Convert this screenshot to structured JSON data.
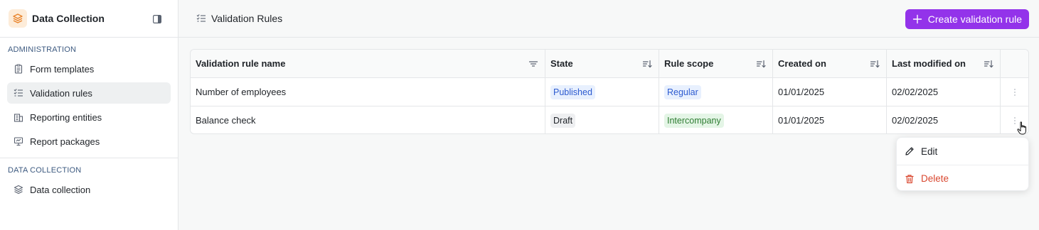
{
  "sidebar": {
    "app_title": "Data Collection",
    "sections": [
      {
        "title": "ADMINISTRATION",
        "items": [
          {
            "label": "Form templates",
            "icon": "clipboard-icon"
          },
          {
            "label": "Validation rules",
            "icon": "checklist-icon",
            "active": true
          },
          {
            "label": "Reporting entities",
            "icon": "building-icon"
          },
          {
            "label": "Report packages",
            "icon": "presentation-icon"
          }
        ]
      },
      {
        "title": "DATA COLLECTION",
        "items": [
          {
            "label": "Data collection",
            "icon": "layers-icon"
          }
        ]
      }
    ]
  },
  "header": {
    "title": "Validation Rules",
    "create_button": "Create validation rule",
    "accent_color": "#9333ea"
  },
  "table": {
    "columns": [
      "Validation rule name",
      "State",
      "Rule scope",
      "Created on",
      "Last modified on"
    ],
    "rows": [
      {
        "name": "Number of employees",
        "state": "Published",
        "scope": "Regular",
        "created": "01/01/2025",
        "modified": "02/02/2025"
      },
      {
        "name": "Balance check",
        "state": "Draft",
        "scope": "Intercompany",
        "created": "01/01/2025",
        "modified": "02/02/2025"
      }
    ]
  },
  "context_menu": {
    "edit": "Edit",
    "delete": "Delete",
    "delete_color": "#d9472f"
  }
}
